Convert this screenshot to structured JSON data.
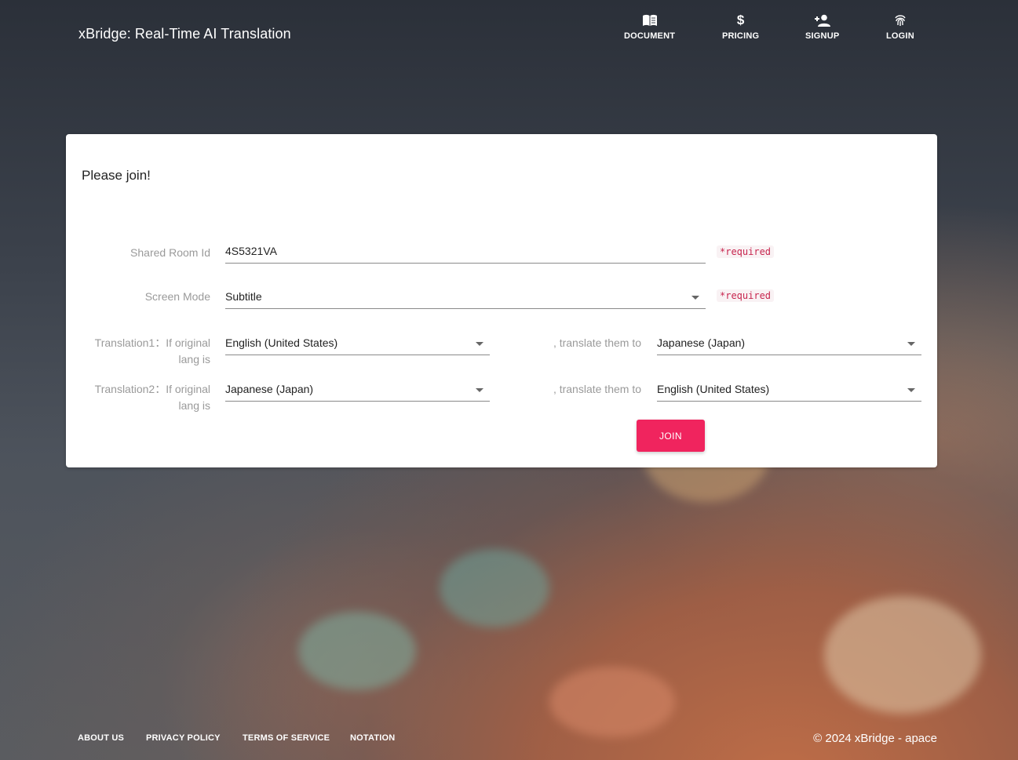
{
  "header": {
    "brand": "xBridge: Real-Time AI Translation",
    "nav": [
      {
        "label": "DOCUMENT",
        "icon": "book-open-icon"
      },
      {
        "label": "PRICING",
        "icon": "dollar-icon"
      },
      {
        "label": "SIGNUP",
        "icon": "person-add-icon"
      },
      {
        "label": "LOGIN",
        "icon": "fingerprint-icon"
      }
    ]
  },
  "form": {
    "title": "Please join!",
    "room_id": {
      "label": "Shared Room Id",
      "value": "4S5321VA",
      "required": "*required"
    },
    "screen_mode": {
      "label": "Screen Mode",
      "value": "Subtitle",
      "required": "*required"
    },
    "translation1": {
      "label": "Translation1：If original lang is",
      "source": "English (United States)",
      "connector": ", translate them to",
      "target": "Japanese (Japan)"
    },
    "translation2": {
      "label": "Translation2：If original lang is",
      "source": "Japanese (Japan)",
      "connector": ", translate them to",
      "target": "English (United States)"
    },
    "join_label": "JOIN"
  },
  "colors": {
    "accent": "#f0245e",
    "required_text": "#c7254e"
  },
  "footer": {
    "links": [
      "ABOUT US",
      "PRIVACY POLICY",
      "TERMS OF SERVICE",
      "NOTATION"
    ],
    "copyright": "© 2024 xBridge - apace"
  }
}
